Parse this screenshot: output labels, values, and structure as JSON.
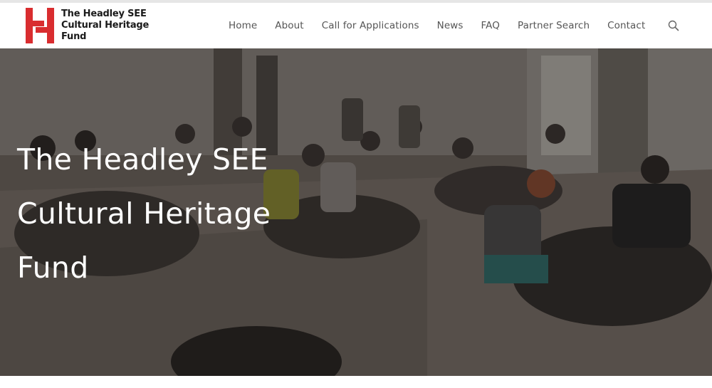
{
  "header": {
    "logo": {
      "line1": "The Headley SEE",
      "line2": "Cultural Heritage",
      "line3": "Fund",
      "mark_color": "#d92d2f"
    },
    "nav": [
      {
        "label": "Home"
      },
      {
        "label": "About"
      },
      {
        "label": "Call for Applications"
      },
      {
        "label": "News"
      },
      {
        "label": "FAQ"
      },
      {
        "label": "Partner Search"
      },
      {
        "label": "Contact"
      }
    ],
    "search_icon": "search-icon"
  },
  "hero": {
    "title_line1": "The Headley SEE",
    "title_line2": "Cultural Heritage",
    "title_line3": "Fund"
  }
}
